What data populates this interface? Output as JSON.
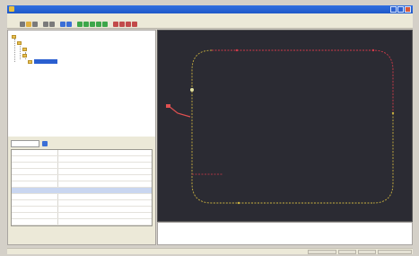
{
  "window": {
    "title": ""
  },
  "menu": [],
  "toolbar": {
    "colors": {
      "green": "#3da64a",
      "blue": "#3b6fd6",
      "red": "#c24a4a",
      "gray": "#7a7a7a",
      "yellow": "#e0b040"
    }
  },
  "tree": {
    "nodes": [
      {
        "level": 0,
        "label": ""
      },
      {
        "level": 1,
        "label": ""
      },
      {
        "level": 2,
        "label": ""
      },
      {
        "level": 2,
        "label": ""
      },
      {
        "level": 3,
        "label": "",
        "selected": true
      }
    ]
  },
  "properties": {
    "tab_label": "",
    "rows": [
      {
        "key": "",
        "value": "",
        "type": "row"
      },
      {
        "key": "",
        "value": "",
        "type": "row"
      },
      {
        "key": "",
        "value": "",
        "type": "row"
      },
      {
        "key": "",
        "value": "",
        "type": "row"
      },
      {
        "key": "",
        "value": "",
        "type": "row"
      },
      {
        "key": "",
        "value": "",
        "type": "row"
      },
      {
        "key": "",
        "value": "",
        "type": "cat"
      },
      {
        "key": "",
        "value": "",
        "type": "row"
      },
      {
        "key": "",
        "value": "",
        "type": "row"
      },
      {
        "key": "",
        "value": "",
        "type": "row"
      },
      {
        "key": "",
        "value": "",
        "type": "row"
      },
      {
        "key": "",
        "value": "",
        "type": "row"
      }
    ]
  },
  "canvas": {
    "background": "#2b2b33",
    "track_color_red": "#d23a4a",
    "track_color_yellow": "#c8b040",
    "marker_color": "#e05050"
  }
}
